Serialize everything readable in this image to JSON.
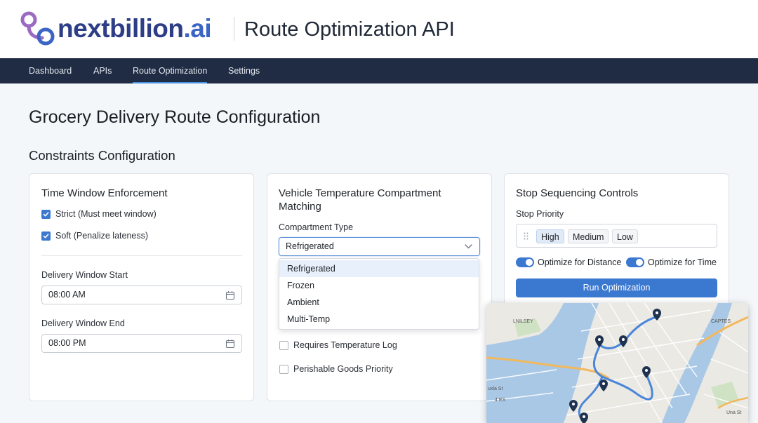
{
  "header": {
    "logo_text_main": "nextbillion",
    "logo_text_suffix": ".ai",
    "title": "Route Optimization API"
  },
  "nav": {
    "items": [
      {
        "label": "Dashboard"
      },
      {
        "label": "APIs"
      },
      {
        "label": "Route Optimization",
        "active": true
      },
      {
        "label": "Settings"
      }
    ]
  },
  "page": {
    "title": "Grocery Delivery Route Configuration",
    "section_title": "Constraints Configuration"
  },
  "time_window": {
    "title": "Time Window Enforcement",
    "options": [
      {
        "label": "Strict (Must meet window)",
        "checked": true
      },
      {
        "label": "Soft (Penalize lateness)",
        "checked": true
      }
    ],
    "start_label": "Delivery Window Start",
    "start_value": "08:00 AM",
    "end_label": "Delivery Window End",
    "end_value": "08:00 PM"
  },
  "temperature": {
    "title_line1": "Vehicle Temperature Compartment",
    "title_line2": "Matching",
    "compartment_label": "Compartment Type",
    "selected": "Refrigerated",
    "options": [
      "Refrigerated",
      "Frozen",
      "Ambient",
      "Multi-Temp"
    ],
    "checkboxes": [
      {
        "label": "Requires Temperature Log",
        "checked": false
      },
      {
        "label": "Perishable Goods Priority",
        "checked": false
      }
    ]
  },
  "sequencing": {
    "title": "Stop Sequencing Controls",
    "priority_label": "Stop Priority",
    "priority_tags": [
      "High",
      "Medium",
      "Low"
    ],
    "toggles": [
      {
        "label": "Optimize for Distance",
        "on": true
      },
      {
        "label": "Optimize for Time",
        "on": true
      }
    ],
    "run_button": "Run Optimization"
  },
  "map": {
    "labels": [
      "LNILSEY",
      "CAPTES",
      "uxla St",
      "4 ES",
      "Una St"
    ]
  },
  "colors": {
    "nav_bg": "#1f2c44",
    "accent": "#3b78d0",
    "logo_purple": "#9b6bc2",
    "logo_blue": "#2d3e87",
    "route": "#4a86d9",
    "water": "#a9c8e6"
  }
}
